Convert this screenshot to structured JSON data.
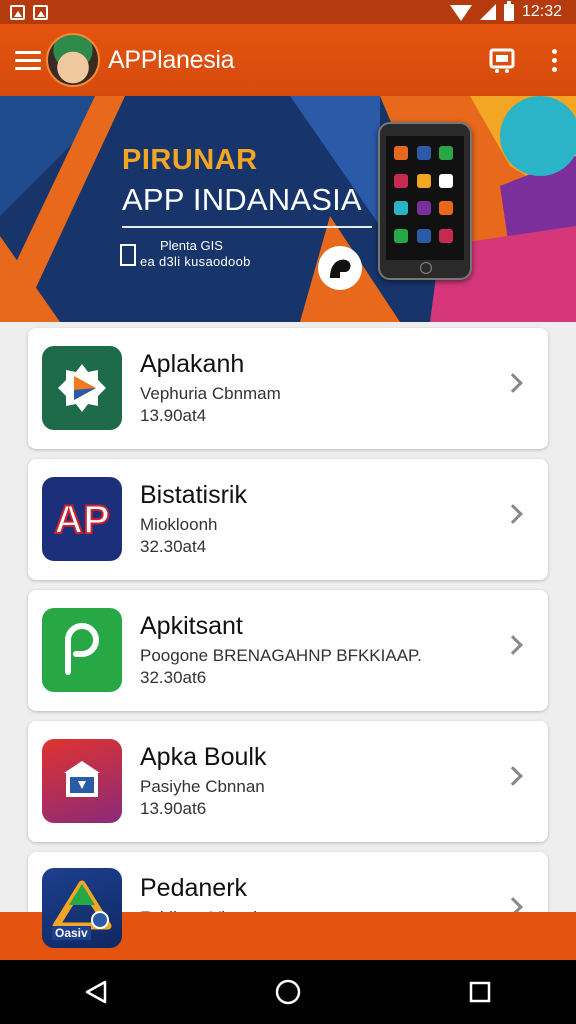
{
  "status_bar": {
    "time": "12:32",
    "icons": [
      "image-notification-icon",
      "photo-notification-icon",
      "wifi-icon",
      "signal-icon",
      "battery-icon"
    ]
  },
  "app_bar": {
    "title": "APPlanesia",
    "menu_icon": "hamburger-menu-icon",
    "action_icon": "cart-icon",
    "more_icon": "more-vertical-icon"
  },
  "banner": {
    "kicker": "PIRUNAR",
    "title": "APP INDANASIA",
    "line1": "Plenta GIS",
    "line2": "ea d3li kusaodoob",
    "colors": {
      "navy": "#17356b",
      "orange": "#e8691c",
      "gold": "#f2a623"
    }
  },
  "apps": [
    {
      "name": "Aplakanh",
      "developer": "Vephuria Cbnmam",
      "version": "13.90at4",
      "icon": "play-badge-icon",
      "icon_bg": "#1e6b4a"
    },
    {
      "name": "Bistatisrik",
      "developer": "Miokloonh",
      "version": "32.30at4",
      "icon": "ap-logo-icon",
      "icon_bg": "#1c2f7a"
    },
    {
      "name": "Apkitsant",
      "developer": "Poogone BRENAGAHNP BFKKIAAP.",
      "version": "32.30at6",
      "icon": "p-chat-icon",
      "icon_bg": "#28a745"
    },
    {
      "name": "Apka Boulk",
      "developer": "Pasiyhe Cbnnan",
      "version": "13.90at6",
      "icon": "store-bag-icon",
      "icon_bg": "#c62a4e"
    },
    {
      "name": "Pedanerk",
      "developer": "Fabilonn Vlapel",
      "version": "",
      "icon": "triangle-logo-icon",
      "icon_bg": "#1d3f8f"
    }
  ],
  "floating_icon": {
    "label": "Oasiv",
    "icon": "triangle-logo-icon"
  },
  "nav_bar": {
    "back_icon": "back-triangle-icon",
    "home_icon": "home-circle-icon",
    "recents_icon": "recents-square-icon"
  }
}
